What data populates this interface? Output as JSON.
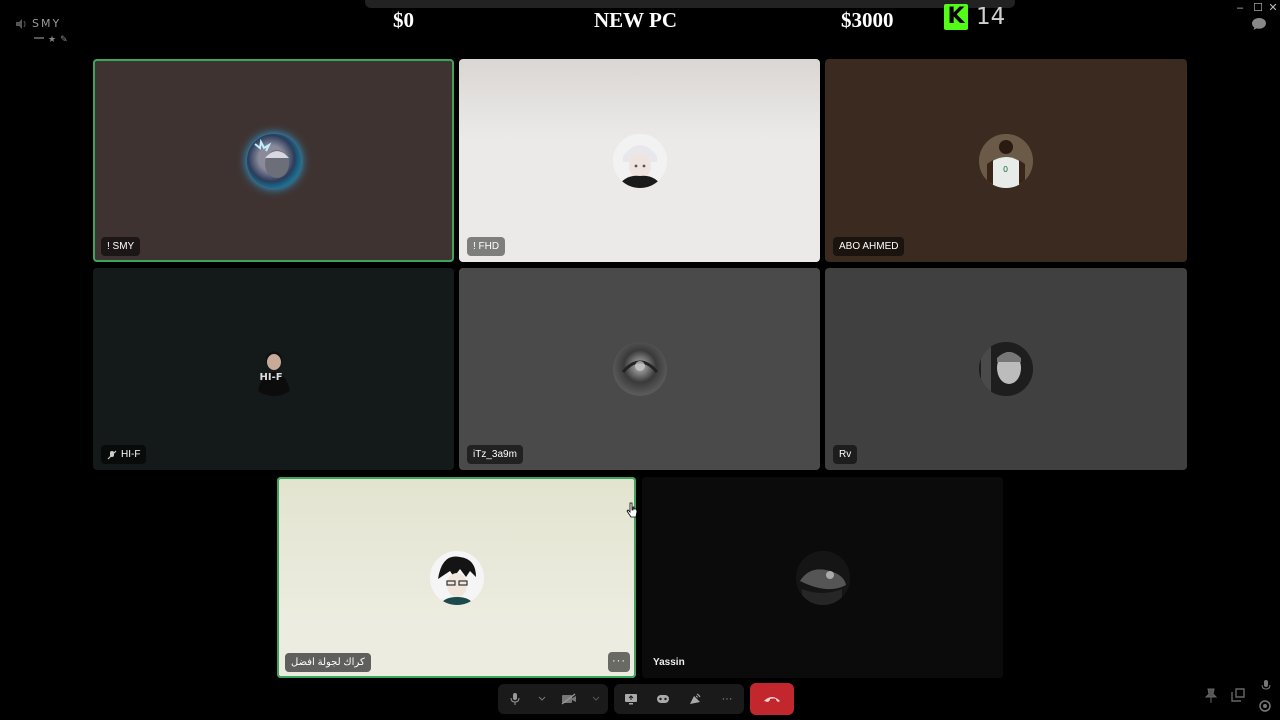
{
  "window": {
    "minimize": "–",
    "maximize": "☐",
    "close": "✕"
  },
  "user": {
    "name": "SMY"
  },
  "banner": {
    "left": "$0",
    "center": "NEW PC",
    "right": "$3000"
  },
  "kick": {
    "logo": "K",
    "count": "14",
    "accent": "#53fc18"
  },
  "tiles": [
    {
      "name": "! SMY",
      "bg": "#3f3331",
      "speaking": true
    },
    {
      "name": "! FHD",
      "bg": "#e9e6e4",
      "speaking": false
    },
    {
      "name": "ABO AHMED",
      "bg": "#3a2a20",
      "speaking": false
    },
    {
      "name": "HI-F",
      "bg": "#141a19",
      "speaking": false,
      "avatar_text": "HI-F"
    },
    {
      "name": "iTz_3a9m",
      "bg": "#4a4a4a",
      "speaking": false
    },
    {
      "name": "Rv",
      "bg": "#404040",
      "speaking": false
    },
    {
      "name": "كراك لجولة افضل",
      "bg": "#e5e6d2",
      "speaking": true,
      "more": "···"
    },
    {
      "name": "Yassin",
      "bg": "#0b0b0b",
      "speaking": false
    }
  ],
  "controls": {
    "icons": [
      "microphone-icon",
      "camera-off-icon",
      "screen-share-icon",
      "activity-icon",
      "soundboard-icon",
      "more-icon",
      "hang-up-icon"
    ],
    "hangup_color": "#c3272e",
    "more": "···"
  }
}
